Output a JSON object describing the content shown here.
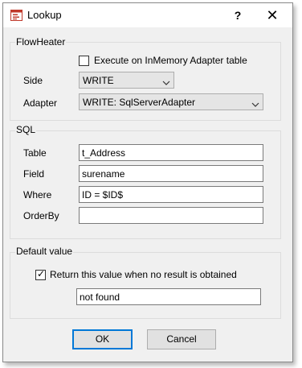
{
  "window": {
    "title": "Lookup",
    "help_glyph": "?",
    "close_glyph": "✕"
  },
  "flowheater": {
    "group_title": "FlowHeater",
    "execute_checkbox_label": "Execute on InMemory Adapter table",
    "execute_checked": false,
    "side_label": "Side",
    "side_value": "WRITE",
    "adapter_label": "Adapter",
    "adapter_value": "WRITE: SqlServerAdapter"
  },
  "sql": {
    "group_title": "SQL",
    "table_label": "Table",
    "table_value": "t_Address",
    "field_label": "Field",
    "field_value": "surename",
    "where_label": "Where",
    "where_value": "ID = $ID$",
    "orderby_label": "OrderBy",
    "orderby_value": ""
  },
  "default_value": {
    "group_title": "Default value",
    "return_checkbox_label": "Return this value when no result is obtained",
    "return_checked": true,
    "check_glyph": "✓",
    "value": "not found"
  },
  "buttons": {
    "ok_label": "OK",
    "cancel_label": "Cancel"
  },
  "colors": {
    "accent": "#0078d7",
    "icon_red": "#c0392b"
  }
}
